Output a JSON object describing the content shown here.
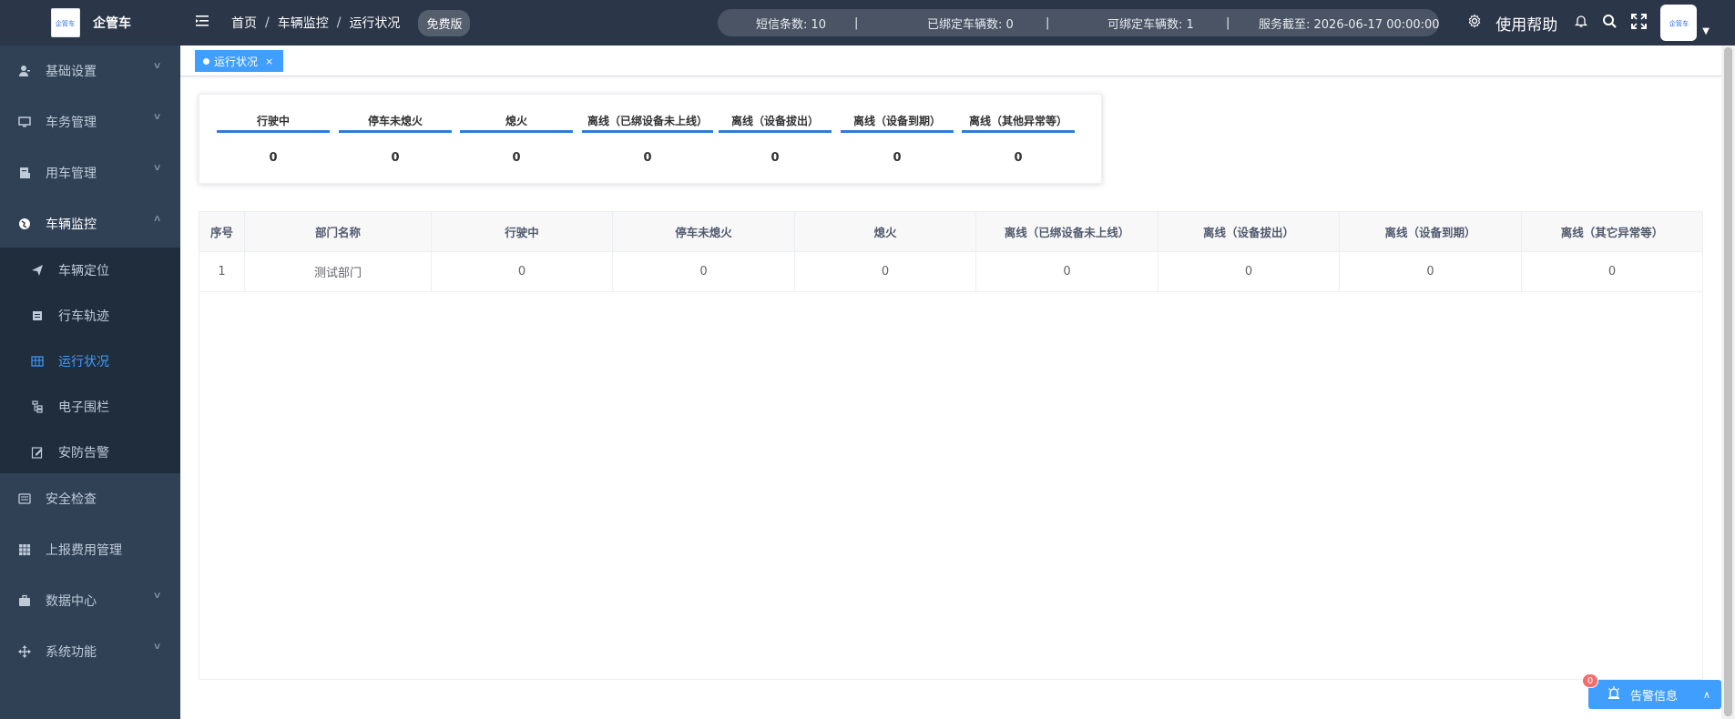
{
  "app": {
    "title": "企管车",
    "logo_text": "企管车"
  },
  "sidebar": {
    "items": [
      {
        "label": "基础设置",
        "icon": "user-icon"
      },
      {
        "label": "车务管理",
        "icon": "monitor-icon"
      },
      {
        "label": "用车管理",
        "icon": "document-icon"
      },
      {
        "label": "车辆监控",
        "icon": "globe-icon"
      },
      {
        "label": "安全检查",
        "icon": "checklist-icon"
      },
      {
        "label": "上报费用管理",
        "icon": "grid-icon"
      },
      {
        "label": "数据中心",
        "icon": "briefcase-icon"
      },
      {
        "label": "系统功能",
        "icon": "move-icon"
      }
    ],
    "sub_items": [
      {
        "label": "车辆定位",
        "icon": "send-icon"
      },
      {
        "label": "行车轨迹",
        "icon": "calendar-icon"
      },
      {
        "label": "运行状况",
        "icon": "table-icon"
      },
      {
        "label": "电子围栏",
        "icon": "tree-icon"
      },
      {
        "label": "安防告警",
        "icon": "edit-icon"
      }
    ],
    "active_sub": "运行状况"
  },
  "topbar": {
    "breadcrumb": [
      "首页",
      "车辆监控",
      "运行状况"
    ],
    "breadcrumb_sep": "/",
    "badge": "免费版",
    "sms_count": "短信条数: 10",
    "bound_count": "已绑定车辆数: 0",
    "bindable_count": "可绑定车辆数: 1",
    "service_until": "服务截至: 2026-06-17 00:00:00",
    "divider": "|",
    "help": "使用帮助"
  },
  "tags": {
    "active_label": "运行状况",
    "close": "×"
  },
  "summary": [
    {
      "label": "行驶中",
      "value": "0"
    },
    {
      "label": "停车未熄火",
      "value": "0"
    },
    {
      "label": "熄火",
      "value": "0"
    },
    {
      "label": "离线（已绑设备未上线）",
      "value": "0"
    },
    {
      "label": "离线（设备拔出）",
      "value": "0"
    },
    {
      "label": "离线（设备到期）",
      "value": "0"
    },
    {
      "label": "离线（其他异常等）",
      "value": "0"
    }
  ],
  "table": {
    "headers": [
      "序号",
      "部门名称",
      "行驶中",
      "停车未熄火",
      "熄火",
      "离线（已绑设备未上线）",
      "离线（设备拔出）",
      "离线（设备到期）",
      "离线（其它异常等）"
    ],
    "rows": [
      [
        "1",
        "测试部门",
        "0",
        "0",
        "0",
        "0",
        "0",
        "0",
        "0"
      ]
    ]
  },
  "alarm": {
    "label": "告警信息",
    "count": "0"
  },
  "colors": {
    "sidebar_bg": "#304156",
    "submenu_bg": "#1f2d3d",
    "topbar_bg": "#2b3649",
    "accent": "#409eff",
    "badge_red": "#f56c6c"
  }
}
